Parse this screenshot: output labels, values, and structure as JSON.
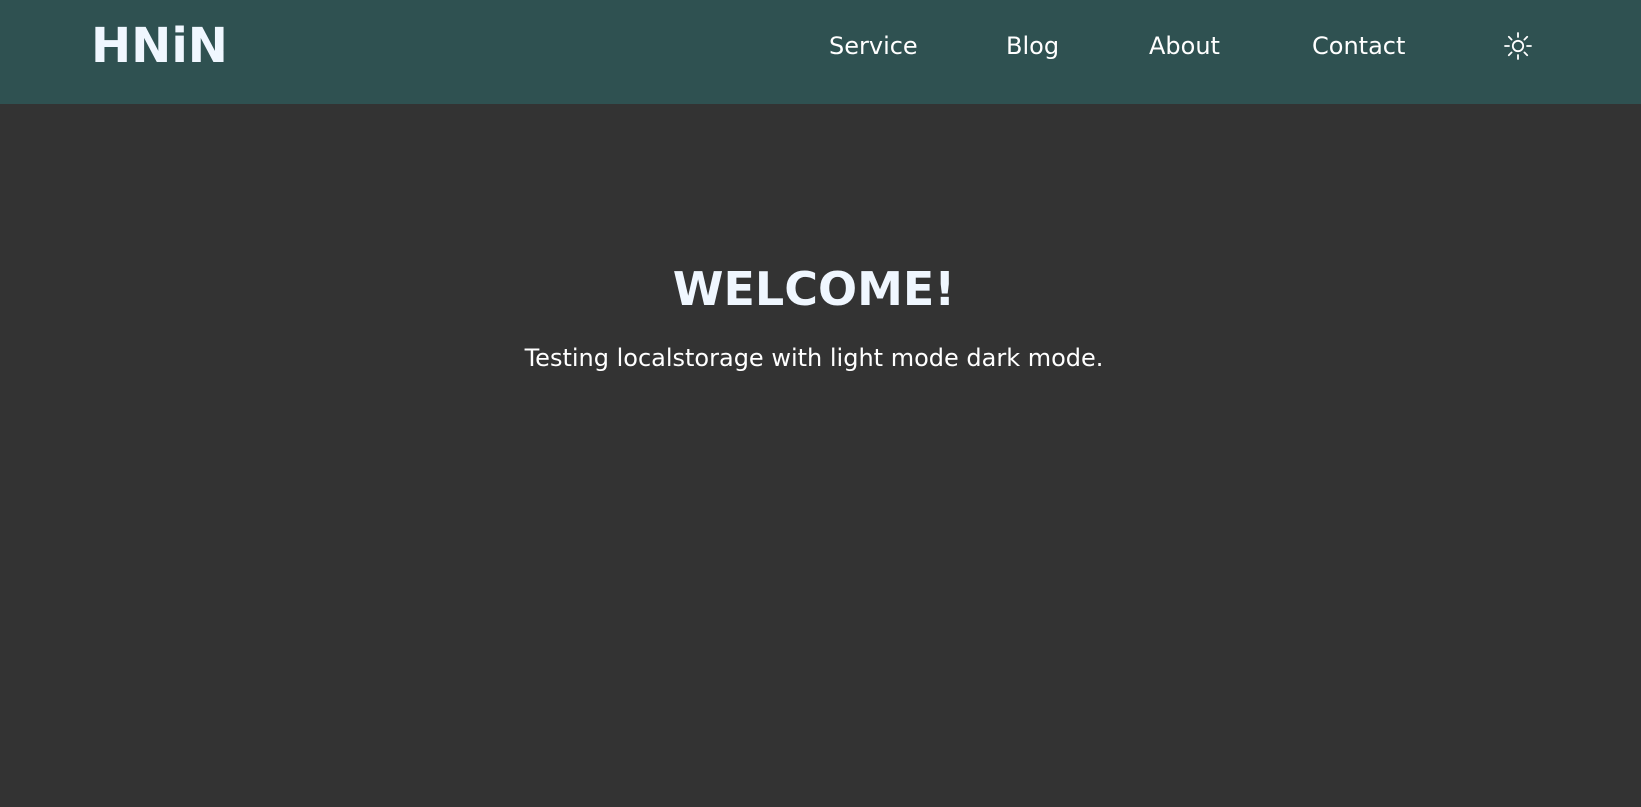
{
  "header": {
    "logo": "HNiN",
    "nav": {
      "service": "Service",
      "blog": "Blog",
      "about": "About",
      "contact": "Contact"
    },
    "theme_toggle_icon": "sun-icon"
  },
  "main": {
    "title": "WELCOME!",
    "subtitle": "Testing localstorage with light mode dark mode."
  },
  "colors": {
    "header_bg": "#2f5151",
    "page_bg": "#333333",
    "text": "#ffffff"
  }
}
